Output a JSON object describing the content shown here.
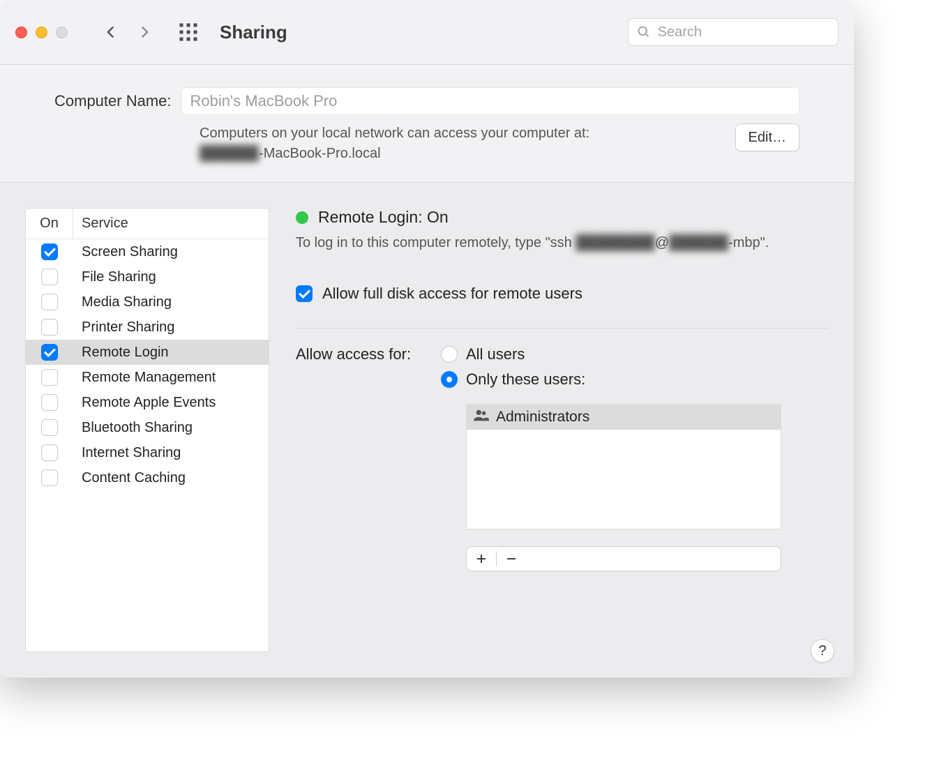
{
  "window": {
    "title": "Sharing"
  },
  "search": {
    "placeholder": "Search"
  },
  "computer_name": {
    "label": "Computer Name:",
    "value": "Robin's MacBook Pro",
    "hint_prefix": "Computers on your local network can access your computer at:",
    "hostname_redacted": "██████",
    "hostname_suffix": "-MacBook-Pro.local",
    "edit_label": "Edit…"
  },
  "services": {
    "col_on": "On",
    "col_service": "Service",
    "items": [
      {
        "label": "Screen Sharing",
        "checked": true,
        "selected": false
      },
      {
        "label": "File Sharing",
        "checked": false,
        "selected": false
      },
      {
        "label": "Media Sharing",
        "checked": false,
        "selected": false
      },
      {
        "label": "Printer Sharing",
        "checked": false,
        "selected": false
      },
      {
        "label": "Remote Login",
        "checked": true,
        "selected": true
      },
      {
        "label": "Remote Management",
        "checked": false,
        "selected": false
      },
      {
        "label": "Remote Apple Events",
        "checked": false,
        "selected": false
      },
      {
        "label": "Bluetooth Sharing",
        "checked": false,
        "selected": false
      },
      {
        "label": "Internet Sharing",
        "checked": false,
        "selected": false
      },
      {
        "label": "Content Caching",
        "checked": false,
        "selected": false
      }
    ]
  },
  "detail": {
    "status_title": "Remote Login: On",
    "status_sub_prefix": "To log in to this computer remotely, type \"ssh ",
    "status_sub_user_redacted": "████████",
    "status_sub_at": "@",
    "status_sub_host_redacted": "██████",
    "status_sub_suffix": "-mbp\".",
    "fda_label": "Allow full disk access for remote users",
    "fda_checked": true,
    "access_label": "Allow access for:",
    "radio_all": "All users",
    "radio_only": "Only these users:",
    "radio_selected": "only",
    "users": [
      {
        "label": "Administrators"
      }
    ]
  },
  "help_label": "?"
}
